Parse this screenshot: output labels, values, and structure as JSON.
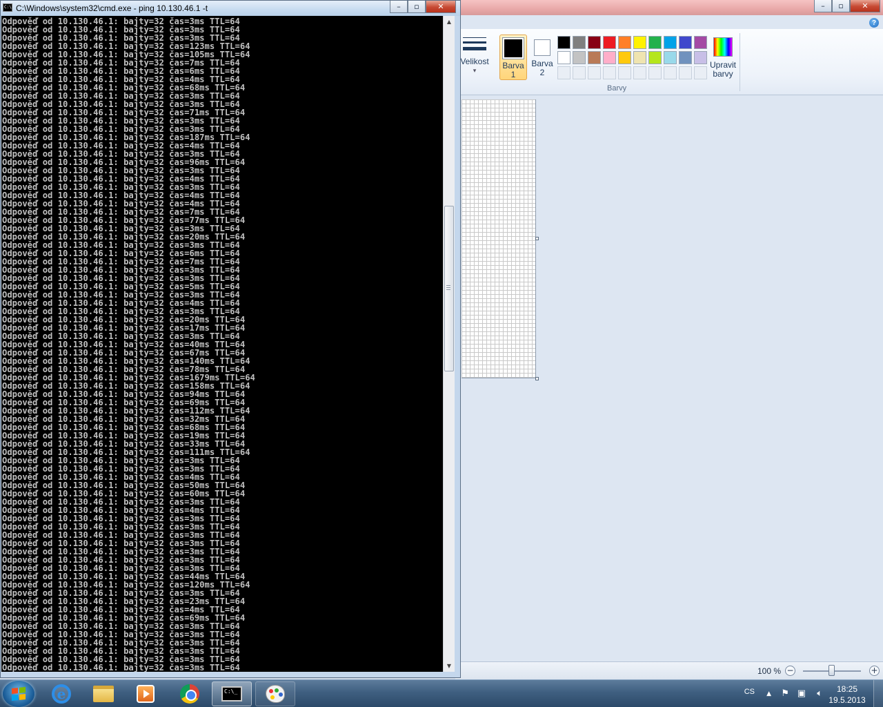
{
  "cmd": {
    "title": "C:\\Windows\\system32\\cmd.exe - ping  10.130.46.1 -t",
    "icon_text": "C:\\",
    "lines": [
      "Odpověď od 10.130.46.1: bajty=32 čas=3ms TTL=64",
      "Odpověď od 10.130.46.1: bajty=32 čas=3ms TTL=64",
      "Odpověď od 10.130.46.1: bajty=32 čas=3ms TTL=64",
      "Odpověď od 10.130.46.1: bajty=32 čas=123ms TTL=64",
      "Odpověď od 10.130.46.1: bajty=32 čas=105ms TTL=64",
      "Odpověď od 10.130.46.1: bajty=32 čas=7ms TTL=64",
      "Odpověď od 10.130.46.1: bajty=32 čas=6ms TTL=64",
      "Odpověď od 10.130.46.1: bajty=32 čas=4ms TTL=64",
      "Odpověď od 10.130.46.1: bajty=32 čas=68ms TTL=64",
      "Odpověď od 10.130.46.1: bajty=32 čas=3ms TTL=64",
      "Odpověď od 10.130.46.1: bajty=32 čas=3ms TTL=64",
      "Odpověď od 10.130.46.1: bajty=32 čas=71ms TTL=64",
      "Odpověď od 10.130.46.1: bajty=32 čas=3ms TTL=64",
      "Odpověď od 10.130.46.1: bajty=32 čas=3ms TTL=64",
      "Odpověď od 10.130.46.1: bajty=32 čas=187ms TTL=64",
      "Odpověď od 10.130.46.1: bajty=32 čas=4ms TTL=64",
      "Odpověď od 10.130.46.1: bajty=32 čas=3ms TTL=64",
      "Odpověď od 10.130.46.1: bajty=32 čas=96ms TTL=64",
      "Odpověď od 10.130.46.1: bajty=32 čas=3ms TTL=64",
      "Odpověď od 10.130.46.1: bajty=32 čas=4ms TTL=64",
      "Odpověď od 10.130.46.1: bajty=32 čas=3ms TTL=64",
      "Odpověď od 10.130.46.1: bajty=32 čas=4ms TTL=64",
      "Odpověď od 10.130.46.1: bajty=32 čas=4ms TTL=64",
      "Odpověď od 10.130.46.1: bajty=32 čas=7ms TTL=64",
      "Odpověď od 10.130.46.1: bajty=32 čas=77ms TTL=64",
      "Odpověď od 10.130.46.1: bajty=32 čas=3ms TTL=64",
      "Odpověď od 10.130.46.1: bajty=32 čas=20ms TTL=64",
      "Odpověď od 10.130.46.1: bajty=32 čas=3ms TTL=64",
      "Odpověď od 10.130.46.1: bajty=32 čas=6ms TTL=64",
      "Odpověď od 10.130.46.1: bajty=32 čas=7ms TTL=64",
      "Odpověď od 10.130.46.1: bajty=32 čas=3ms TTL=64",
      "Odpověď od 10.130.46.1: bajty=32 čas=3ms TTL=64",
      "Odpověď od 10.130.46.1: bajty=32 čas=5ms TTL=64",
      "Odpověď od 10.130.46.1: bajty=32 čas=3ms TTL=64",
      "Odpověď od 10.130.46.1: bajty=32 čas=4ms TTL=64",
      "Odpověď od 10.130.46.1: bajty=32 čas=3ms TTL=64",
      "Odpověď od 10.130.46.1: bajty=32 čas=20ms TTL=64",
      "Odpověď od 10.130.46.1: bajty=32 čas=17ms TTL=64",
      "Odpověď od 10.130.46.1: bajty=32 čas=3ms TTL=64",
      "Odpověď od 10.130.46.1: bajty=32 čas=40ms TTL=64",
      "Odpověď od 10.130.46.1: bajty=32 čas=67ms TTL=64",
      "Odpověď od 10.130.46.1: bajty=32 čas=140ms TTL=64",
      "Odpověď od 10.130.46.1: bajty=32 čas=78ms TTL=64",
      "Odpověď od 10.130.46.1: bajty=32 čas=1679ms TTL=64",
      "Odpověď od 10.130.46.1: bajty=32 čas=158ms TTL=64",
      "Odpověď od 10.130.46.1: bajty=32 čas=94ms TTL=64",
      "Odpověď od 10.130.46.1: bajty=32 čas=69ms TTL=64",
      "Odpověď od 10.130.46.1: bajty=32 čas=112ms TTL=64",
      "Odpověď od 10.130.46.1: bajty=32 čas=32ms TTL=64",
      "Odpověď od 10.130.46.1: bajty=32 čas=68ms TTL=64",
      "Odpověď od 10.130.46.1: bajty=32 čas=19ms TTL=64",
      "Odpověď od 10.130.46.1: bajty=32 čas=33ms TTL=64",
      "Odpověď od 10.130.46.1: bajty=32 čas=111ms TTL=64",
      "Odpověď od 10.130.46.1: bajty=32 čas=3ms TTL=64",
      "Odpověď od 10.130.46.1: bajty=32 čas=3ms TTL=64",
      "Odpověď od 10.130.46.1: bajty=32 čas=4ms TTL=64",
      "Odpověď od 10.130.46.1: bajty=32 čas=50ms TTL=64",
      "Odpověď od 10.130.46.1: bajty=32 čas=60ms TTL=64",
      "Odpověď od 10.130.46.1: bajty=32 čas=3ms TTL=64",
      "Odpověď od 10.130.46.1: bajty=32 čas=4ms TTL=64",
      "Odpověď od 10.130.46.1: bajty=32 čas=3ms TTL=64",
      "Odpověď od 10.130.46.1: bajty=32 čas=3ms TTL=64",
      "Odpověď od 10.130.46.1: bajty=32 čas=3ms TTL=64",
      "Odpověď od 10.130.46.1: bajty=32 čas=3ms TTL=64",
      "Odpověď od 10.130.46.1: bajty=32 čas=3ms TTL=64",
      "Odpověď od 10.130.46.1: bajty=32 čas=3ms TTL=64",
      "Odpověď od 10.130.46.1: bajty=32 čas=3ms TTL=64",
      "Odpověď od 10.130.46.1: bajty=32 čas=44ms TTL=64",
      "Odpověď od 10.130.46.1: bajty=32 čas=120ms TTL=64",
      "Odpověď od 10.130.46.1: bajty=32 čas=3ms TTL=64",
      "Odpověď od 10.130.46.1: bajty=32 čas=23ms TTL=64",
      "Odpověď od 10.130.46.1: bajty=32 čas=4ms TTL=64",
      "Odpověď od 10.130.46.1: bajty=32 čas=69ms TTL=64",
      "Odpověď od 10.130.46.1: bajty=32 čas=3ms TTL=64",
      "Odpověď od 10.130.46.1: bajty=32 čas=3ms TTL=64",
      "Odpověď od 10.130.46.1: bajty=32 čas=3ms TTL=64",
      "Odpověď od 10.130.46.1: bajty=32 čas=3ms TTL=64",
      "Odpověď od 10.130.46.1: bajty=32 čas=3ms TTL=64",
      "Odpověď od 10.130.46.1: bajty=32 čas=3ms TTL=64"
    ],
    "colors": {
      "background": "#000000",
      "text": "#c0c0c0"
    }
  },
  "window_buttons": {
    "minimize": "–",
    "maximize": "▫",
    "close": "✕"
  },
  "paint": {
    "help_icon": "?",
    "size_button": {
      "label": "Velikost",
      "arrow": "▾"
    },
    "color1_button": {
      "label_line1": "Barva",
      "label_line2": "1",
      "color": "#000000"
    },
    "color2_button": {
      "label_line1": "Barva",
      "label_line2": "2",
      "color": "#ffffff"
    },
    "edit_colors_button": {
      "label_line1": "Upravit",
      "label_line2": "barvy"
    },
    "colors_group_label": "Barvy",
    "palette": [
      "#000000",
      "#7f7f7f",
      "#880015",
      "#ed1c24",
      "#ff7f27",
      "#fff200",
      "#22b14c",
      "#00a2e8",
      "#3f48cc",
      "#a349a4",
      "#ffffff",
      "#c3c3c3",
      "#b97a57",
      "#ffaec9",
      "#ffc90e",
      "#efe4b0",
      "#b5e61d",
      "#99d9ea",
      "#7092be",
      "#c8bfe7",
      "",
      "",
      "",
      "",
      "",
      "",
      "",
      "",
      "",
      ""
    ],
    "zoom_label": "100 %",
    "zoom_out": "−",
    "zoom_in": "+",
    "zoom_level_percent": 100
  },
  "taskbar": {
    "language": "CS",
    "tray_arrow": "▲",
    "time": "18:25",
    "date": "19.5.2013",
    "cmd_icon_text": "C:\\_"
  }
}
